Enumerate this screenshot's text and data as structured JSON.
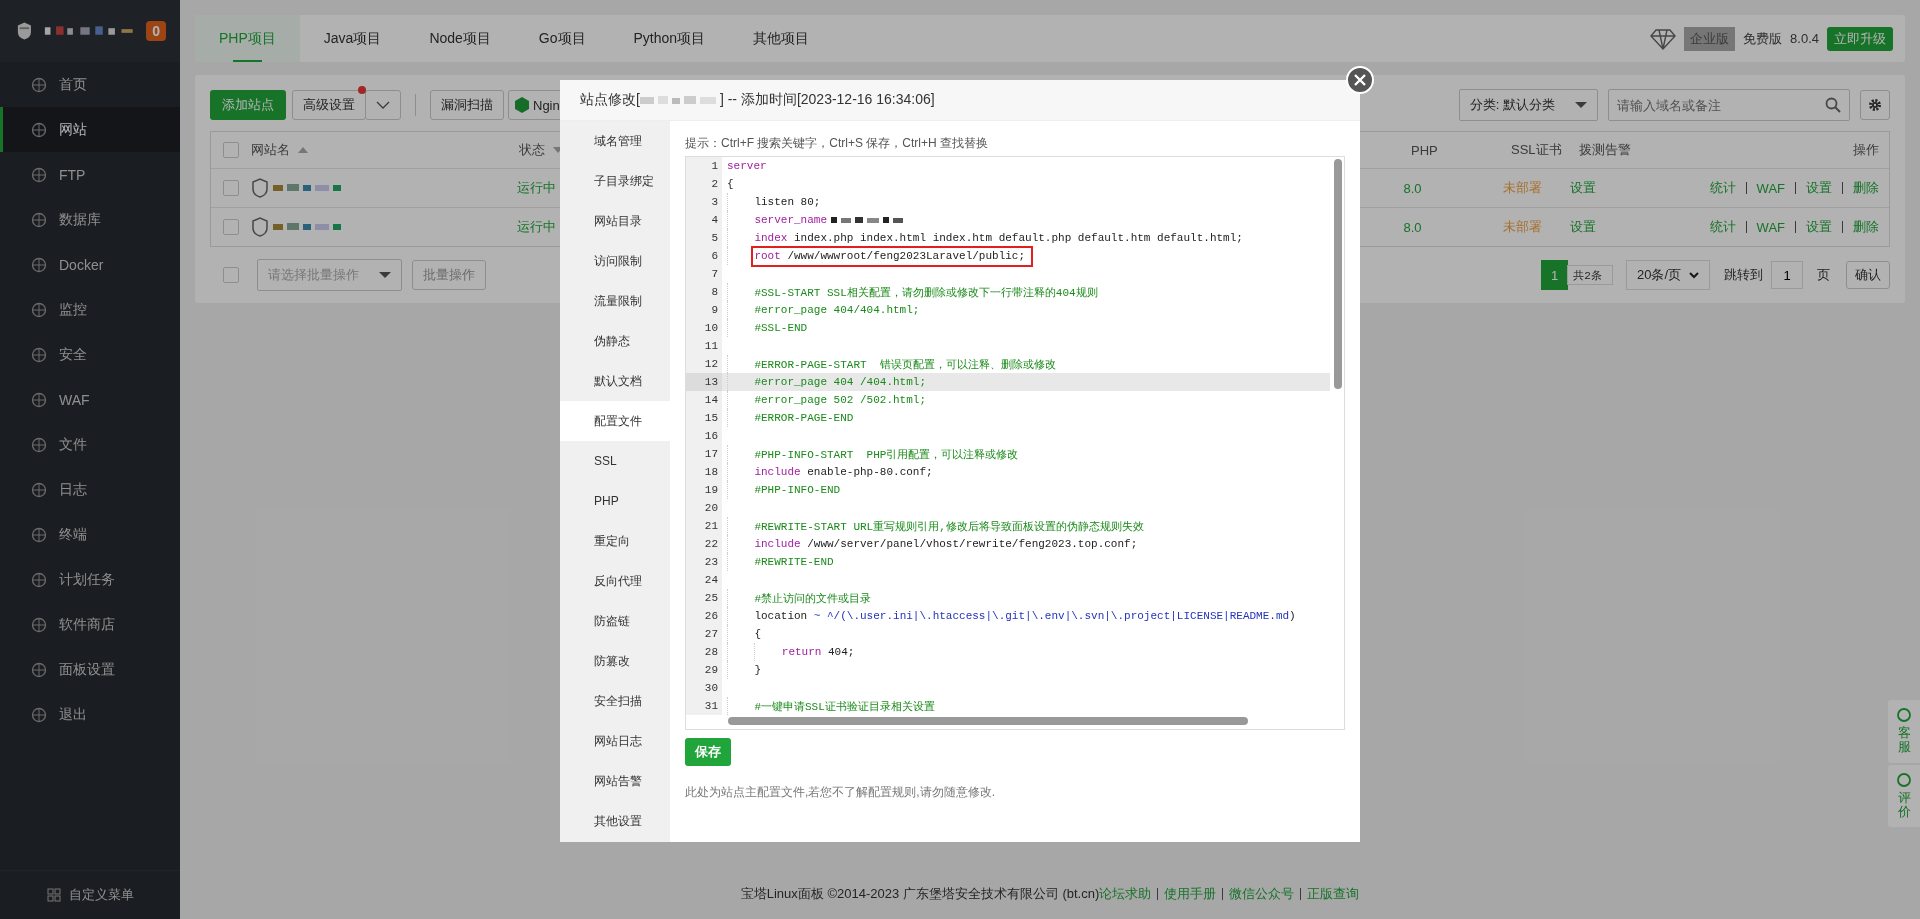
{
  "sidebar": {
    "badge": "0",
    "items": [
      {
        "label": "首页",
        "selected": false
      },
      {
        "label": "网站",
        "selected": true
      },
      {
        "label": "FTP",
        "selected": false
      },
      {
        "label": "数据库",
        "selected": false
      },
      {
        "label": "Docker",
        "selected": false
      },
      {
        "label": "监控",
        "selected": false
      },
      {
        "label": "安全",
        "selected": false
      },
      {
        "label": "WAF",
        "selected": false
      },
      {
        "label": "文件",
        "selected": false
      },
      {
        "label": "日志",
        "selected": false
      },
      {
        "label": "终端",
        "selected": false
      },
      {
        "label": "计划任务",
        "selected": false
      },
      {
        "label": "软件商店",
        "selected": false
      },
      {
        "label": "面板设置",
        "selected": false
      },
      {
        "label": "退出",
        "selected": false
      }
    ],
    "footer": "自定义菜单"
  },
  "tabs": [
    {
      "label": "PHP项目",
      "selected": true
    },
    {
      "label": "Java项目",
      "selected": false
    },
    {
      "label": "Node项目",
      "selected": false
    },
    {
      "label": "Go项目",
      "selected": false
    },
    {
      "label": "Python项目",
      "selected": false
    },
    {
      "label": "其他项目",
      "selected": false
    }
  ],
  "edition": {
    "enterprise": "企业版",
    "free": "免费版",
    "version": "8.0.4",
    "upgrade": "立即升级"
  },
  "toolbar": {
    "add": "添加站点",
    "advanced": "高级设置",
    "advanced_notify": true,
    "scan": "漏洞扫描",
    "nginx": "Ngin",
    "category": "分类: 默认分类",
    "search_placeholder": "请输入域名或备注"
  },
  "table": {
    "columns": [
      {
        "label": "网站名",
        "ascending": true
      },
      {
        "label": "状态",
        "ascending": false
      },
      {
        "label": "PHP"
      },
      {
        "label": "SSL证书"
      },
      {
        "label": "拨测告警"
      },
      {
        "label": "操作"
      }
    ],
    "select_all_checked": false,
    "rows": [
      {
        "checked": false,
        "status": "运行中",
        "php": "8.0",
        "ssl": "未部署",
        "alert": "设置",
        "actions": [
          "统计",
          "WAF",
          "设置",
          "删除"
        ]
      },
      {
        "checked": false,
        "status": "运行中",
        "php": "8.0",
        "ssl": "未部署",
        "alert": "设置",
        "actions": [
          "统计",
          "WAF",
          "设置",
          "删除"
        ]
      }
    ]
  },
  "batch": {
    "checked": false,
    "placeholder": "请选择批量操作",
    "button": "批量操作"
  },
  "pagination": {
    "pages": [
      {
        "label": "1",
        "selected": true
      }
    ],
    "total": "共2条",
    "per_page": "20条/页",
    "goto": "跳转到",
    "goto_value": "1",
    "page_unit": "页",
    "confirm": "确认"
  },
  "footer": {
    "copyright": "宝塔Linux面板 ©2014-2023 广东堡塔安全技术有限公司 (bt.cn)",
    "links": [
      "论坛求助",
      "使用手册",
      "微信公众号",
      "正版查询"
    ]
  },
  "float_buttons": [
    "客服",
    "评价"
  ],
  "dialog": {
    "title_prefix": "站点修改[",
    "title_suffix": "] -- 添加时间[2023-12-16 16:34:06]",
    "nav": [
      {
        "label": "域名管理",
        "selected": false
      },
      {
        "label": "子目录绑定",
        "selected": false
      },
      {
        "label": "网站目录",
        "selected": false
      },
      {
        "label": "访问限制",
        "selected": false
      },
      {
        "label": "流量限制",
        "selected": false
      },
      {
        "label": "伪静态",
        "selected": false
      },
      {
        "label": "默认文档",
        "selected": false
      },
      {
        "label": "配置文件",
        "selected": true
      },
      {
        "label": "SSL",
        "selected": false
      },
      {
        "label": "PHP",
        "selected": false
      },
      {
        "label": "重定向",
        "selected": false
      },
      {
        "label": "反向代理",
        "selected": false
      },
      {
        "label": "防盗链",
        "selected": false
      },
      {
        "label": "防篡改",
        "selected": false
      },
      {
        "label": "安全扫描",
        "selected": false
      },
      {
        "label": "网站日志",
        "selected": false
      },
      {
        "label": "网站告警",
        "selected": false
      },
      {
        "label": "其他设置",
        "selected": false
      }
    ],
    "hint": "提示：Ctrl+F 搜索关键字，Ctrl+S 保存，Ctrl+H 查找替换",
    "lines": [
      {
        "n": "1",
        "current": false,
        "boxed": false,
        "tokens": [
          {
            "kind": "keyword",
            "text": "server"
          }
        ]
      },
      {
        "n": "2",
        "current": false,
        "boxed": false,
        "tokens": [
          {
            "kind": "plain",
            "text": "{"
          }
        ]
      },
      {
        "n": "3",
        "current": false,
        "boxed": false,
        "tokens": [
          {
            "kind": "plain",
            "text": "    listen 80;"
          }
        ]
      },
      {
        "n": "4",
        "current": false,
        "boxed": false,
        "tokens": [
          {
            "kind": "keyword",
            "text": "    server_name"
          },
          {
            "kind": "redacted"
          }
        ]
      },
      {
        "n": "5",
        "current": false,
        "boxed": false,
        "tokens": [
          {
            "kind": "keyword",
            "text": "    index"
          },
          {
            "kind": "plain",
            "text": " index.php index.html index.htm default.php default.htm default.html;"
          }
        ]
      },
      {
        "n": "6",
        "current": false,
        "boxed": true,
        "tokens": [
          {
            "kind": "keyword",
            "text": "    root"
          },
          {
            "kind": "plain",
            "text": " /www/wwwroot/feng2023Laravel/public;"
          }
        ]
      },
      {
        "n": "7",
        "current": false
      },
      {
        "n": "8",
        "current": false,
        "boxed": false,
        "tokens": [
          {
            "kind": "comment",
            "text": "    #SSL-START SSL相关配置，请勿删除或修改下一行带注释的404规则"
          }
        ]
      },
      {
        "n": "9",
        "current": false,
        "boxed": false,
        "tokens": [
          {
            "kind": "comment",
            "text": "    #error_page 404/404.html;"
          }
        ]
      },
      {
        "n": "10",
        "current": false,
        "boxed": false,
        "tokens": [
          {
            "kind": "comment",
            "text": "    #SSL-END"
          }
        ]
      },
      {
        "n": "11",
        "current": false
      },
      {
        "n": "12",
        "current": false,
        "boxed": false,
        "tokens": [
          {
            "kind": "comment",
            "text": "    #ERROR-PAGE-START  错误页配置，可以注释、删除或修改"
          }
        ]
      },
      {
        "n": "13",
        "current": true,
        "boxed": false,
        "tokens": [
          {
            "kind": "comment",
            "text": "    #error_page 404 /404.html;"
          }
        ]
      },
      {
        "n": "14",
        "current": false,
        "boxed": false,
        "tokens": [
          {
            "kind": "comment",
            "text": "    #error_page 502 /502.html;"
          }
        ]
      },
      {
        "n": "15",
        "current": false,
        "boxed": false,
        "tokens": [
          {
            "kind": "comment",
            "text": "    #ERROR-PAGE-END"
          }
        ]
      },
      {
        "n": "16",
        "current": false
      },
      {
        "n": "17",
        "current": false,
        "boxed": false,
        "tokens": [
          {
            "kind": "comment",
            "text": "    #PHP-INFO-START  PHP引用配置，可以注释或修改"
          }
        ]
      },
      {
        "n": "18",
        "current": false,
        "boxed": false,
        "tokens": [
          {
            "kind": "keyword",
            "text": "    include"
          },
          {
            "kind": "plain",
            "text": " enable-php-80.conf;"
          }
        ]
      },
      {
        "n": "19",
        "current": false,
        "boxed": false,
        "tokens": [
          {
            "kind": "comment",
            "text": "    #PHP-INFO-END"
          }
        ]
      },
      {
        "n": "20",
        "current": false
      },
      {
        "n": "21",
        "current": false,
        "boxed": false,
        "tokens": [
          {
            "kind": "comment",
            "text": "    #REWRITE-START URL重写规则引用,修改后将导致面板设置的伪静态规则失效"
          }
        ]
      },
      {
        "n": "22",
        "current": false,
        "boxed": false,
        "tokens": [
          {
            "kind": "keyword",
            "text": "    include"
          },
          {
            "kind": "plain",
            "text": " /www/server/panel/vhost/rewrite/feng2023.top.conf;"
          }
        ]
      },
      {
        "n": "23",
        "current": false,
        "boxed": false,
        "tokens": [
          {
            "kind": "comment",
            "text": "    #REWRITE-END"
          }
        ]
      },
      {
        "n": "24",
        "current": false
      },
      {
        "n": "25",
        "current": false,
        "boxed": false,
        "tokens": [
          {
            "kind": "comment",
            "text": "    #禁止访问的文件或目录"
          }
        ]
      },
      {
        "n": "26",
        "current": false,
        "boxed": false,
        "tokens": [
          {
            "kind": "plain",
            "text": "    location "
          },
          {
            "kind": "regex",
            "text": "~ ^/(\\.user.ini|\\.htaccess|\\.git|\\.env|\\.svn|\\.project|LICENSE|README.md"
          },
          {
            "kind": "plain",
            "text": ")"
          }
        ]
      },
      {
        "n": "27",
        "current": false,
        "boxed": false,
        "tokens": [
          {
            "kind": "plain",
            "text": "    {"
          }
        ]
      },
      {
        "n": "28",
        "current": false,
        "boxed": false,
        "tokens": [
          {
            "kind": "keyword",
            "text": "        return"
          },
          {
            "kind": "plain",
            "text": " 404;"
          }
        ]
      },
      {
        "n": "29",
        "current": false,
        "boxed": false,
        "tokens": [
          {
            "kind": "plain",
            "text": "    }"
          }
        ]
      },
      {
        "n": "30",
        "current": false
      },
      {
        "n": "31",
        "current": false,
        "boxed": false,
        "tokens": [
          {
            "kind": "comment",
            "text": "    #一键申请SSL证书验证目录相关设置"
          }
        ]
      }
    ],
    "save": "保存",
    "note": "此处为站点主配置文件,若您不了解配置规则,请勿随意修改."
  }
}
